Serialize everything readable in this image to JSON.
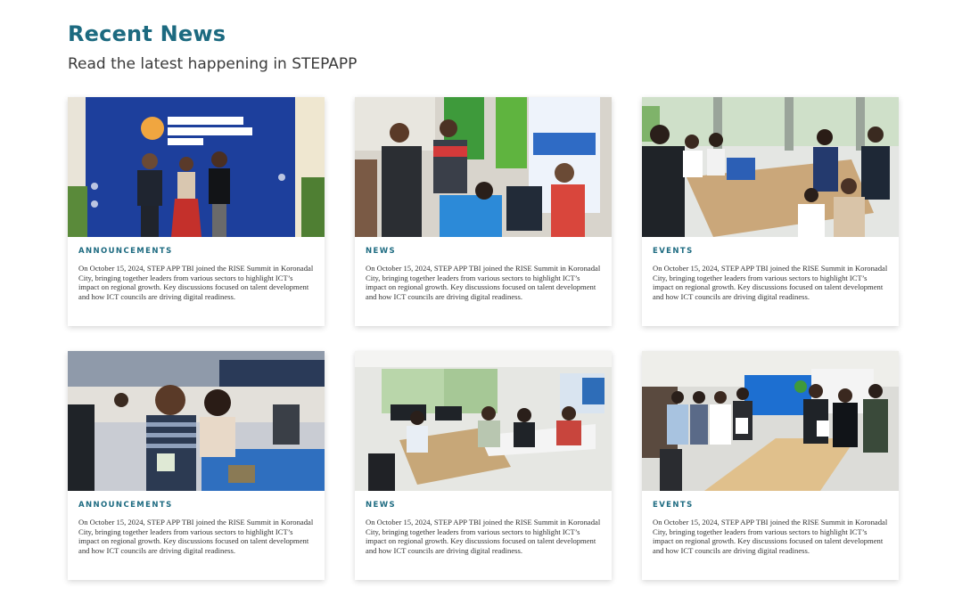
{
  "section": {
    "title": "Recent News",
    "subtitle": "Read the latest happening in STEPAPP"
  },
  "cards": [
    {
      "category": "ANNOUNCEMENTS",
      "excerpt": "On October 15, 2024, STEP APP TBI joined the RISE Summit in Koronadal City, bringing together leaders from various sectors to highlight ICT’s impact on regional growth. Key discussions focused on talent development and how ICT councils are driving digital readiness.",
      "image_alt": "Group photo at Mindanao Infrastructure Summit backdrop"
    },
    {
      "category": "NEWS",
      "excerpt": "On October 15, 2024, STEP APP TBI joined the RISE Summit in Koronadal City, bringing together leaders from various sectors to highlight ICT’s impact on regional growth. Key discussions focused on talent development and how ICT councils are driving digital readiness.",
      "image_alt": "People gathered at a DOST SKSU STEP APP booth"
    },
    {
      "category": "EVENTS",
      "excerpt": "On October 15, 2024, STEP APP TBI joined the RISE Summit in Koronadal City, bringing together leaders from various sectors to highlight ICT’s impact on regional growth. Key discussions focused on talent development and how ICT councils are driving digital readiness.",
      "image_alt": "Group meeting around a conference table"
    },
    {
      "category": "ANNOUNCEMENTS",
      "excerpt": "On October 15, 2024, STEP APP TBI joined the RISE Summit in Koronadal City, bringing together leaders from various sectors to highlight ICT’s impact on regional growth. Key discussions focused on talent development and how ICT councils are driving digital readiness.",
      "image_alt": "Two attendees smiling at a conference"
    },
    {
      "category": "NEWS",
      "excerpt": "On October 15, 2024, STEP APP TBI joined the RISE Summit in Koronadal City, bringing together leaders from various sectors to highlight ICT’s impact on regional growth. Key discussions focused on talent development and how ICT councils are driving digital readiness.",
      "image_alt": "Participants seated at tables in an office workshop"
    },
    {
      "category": "EVENTS",
      "excerpt": "On October 15, 2024, STEP APP TBI joined the RISE Summit in Koronadal City, bringing together leaders from various sectors to highlight ICT’s impact on regional growth. Key discussions focused on talent development and how ICT councils are driving digital readiness.",
      "image_alt": "Group photo holding certificates in a meeting room"
    }
  ],
  "colors": {
    "accent": "#1c6a80",
    "text": "#333333",
    "background": "#ffffff"
  }
}
